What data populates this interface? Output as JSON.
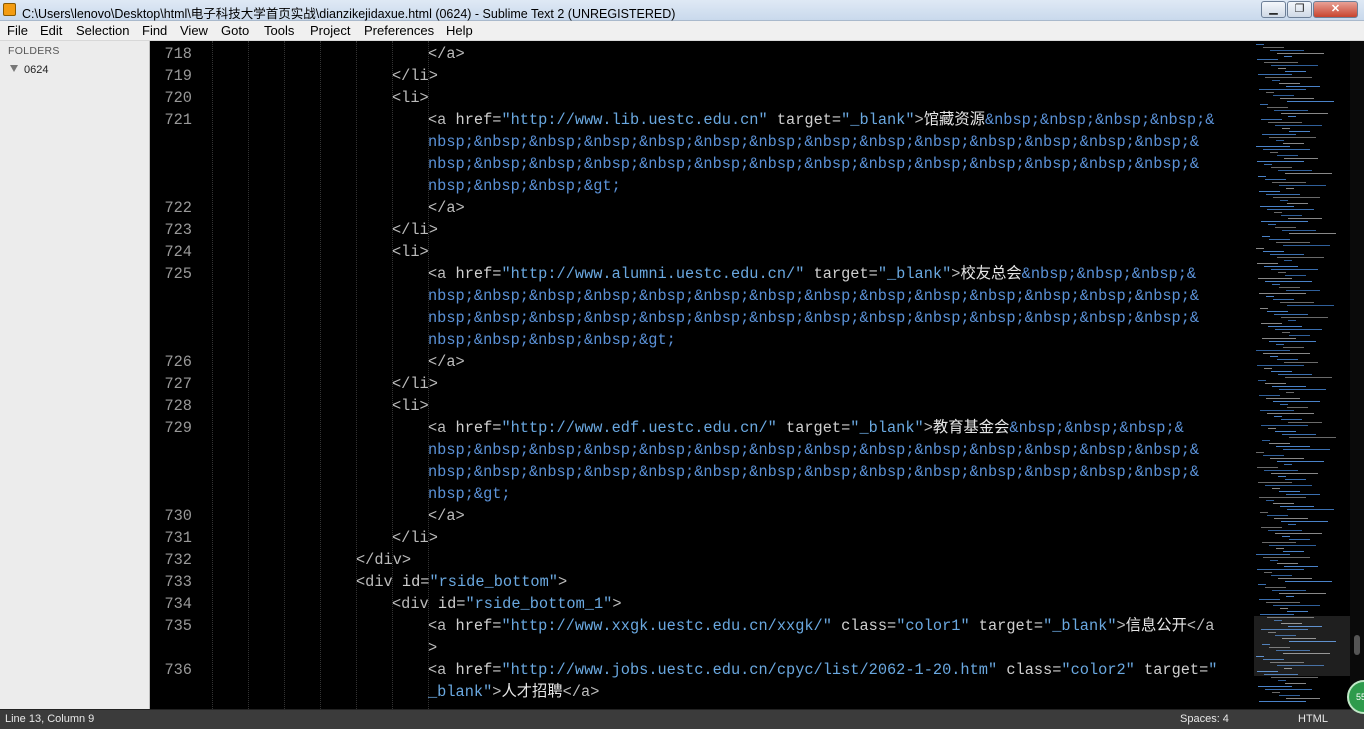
{
  "window": {
    "title": "C:\\Users\\lenovo\\Desktop\\html\\电子科技大学首页实战\\dianzikejidaxue.html (0624) - Sublime Text 2 (UNREGISTERED)",
    "minimize_label": "▁",
    "maximize_label": "❐",
    "close_label": "✕"
  },
  "menu": [
    "File",
    "Edit",
    "Selection",
    "Find",
    "View",
    "Goto",
    "Tools",
    "Project",
    "Preferences",
    "Help"
  ],
  "sidebar": {
    "heading": "FOLDERS",
    "folder": "0624"
  },
  "editor": {
    "lines": [
      {
        "num": "718",
        "indent": 3,
        "parts": [
          {
            "c": "t",
            "t": "</a>"
          }
        ]
      },
      {
        "num": "719",
        "indent": 2,
        "parts": [
          {
            "c": "t",
            "t": "</li>"
          }
        ]
      },
      {
        "num": "720",
        "indent": 2,
        "parts": [
          {
            "c": "t",
            "t": "<li>"
          }
        ]
      },
      {
        "num": "721",
        "indent": 3,
        "parts": [
          {
            "c": "t",
            "t": "<a "
          },
          {
            "c": "a",
            "t": "href="
          },
          {
            "c": "s",
            "t": "\"http://www.lib.uestc.edu.cn\""
          },
          {
            "c": "a",
            "t": " target="
          },
          {
            "c": "s",
            "t": "\"_blank\""
          },
          {
            "c": "t",
            "t": ">"
          },
          {
            "c": "tx",
            "t": "馆藏资源"
          },
          {
            "c": "v",
            "t": "&nbsp;&nbsp;&nbsp;&nbsp;&"
          }
        ]
      },
      {
        "num": "",
        "indent": 3,
        "parts": [
          {
            "c": "v",
            "t": "nbsp;&nbsp;&nbsp;&nbsp;&nbsp;&nbsp;&nbsp;&nbsp;&nbsp;&nbsp;&nbsp;&nbsp;&nbsp;&nbsp;&"
          }
        ]
      },
      {
        "num": "",
        "indent": 3,
        "parts": [
          {
            "c": "v",
            "t": "nbsp;&nbsp;&nbsp;&nbsp;&nbsp;&nbsp;&nbsp;&nbsp;&nbsp;&nbsp;&nbsp;&nbsp;&nbsp;&nbsp;&"
          }
        ]
      },
      {
        "num": "",
        "indent": 3,
        "parts": [
          {
            "c": "v",
            "t": "nbsp;&nbsp;&nbsp;&gt;"
          }
        ]
      },
      {
        "num": "722",
        "indent": 3,
        "parts": [
          {
            "c": "t",
            "t": "</a>"
          }
        ]
      },
      {
        "num": "723",
        "indent": 2,
        "parts": [
          {
            "c": "t",
            "t": "</li>"
          }
        ]
      },
      {
        "num": "724",
        "indent": 2,
        "parts": [
          {
            "c": "t",
            "t": "<li>"
          }
        ]
      },
      {
        "num": "725",
        "indent": 3,
        "parts": [
          {
            "c": "t",
            "t": "<a "
          },
          {
            "c": "a",
            "t": "href="
          },
          {
            "c": "s",
            "t": "\"http://www.alumni.uestc.edu.cn/\""
          },
          {
            "c": "a",
            "t": " target="
          },
          {
            "c": "s",
            "t": "\"_blank\""
          },
          {
            "c": "t",
            "t": ">"
          },
          {
            "c": "tx",
            "t": "校友总会"
          },
          {
            "c": "v",
            "t": "&nbsp;&nbsp;&nbsp;&"
          }
        ]
      },
      {
        "num": "",
        "indent": 3,
        "parts": [
          {
            "c": "v",
            "t": "nbsp;&nbsp;&nbsp;&nbsp;&nbsp;&nbsp;&nbsp;&nbsp;&nbsp;&nbsp;&nbsp;&nbsp;&nbsp;&nbsp;&"
          }
        ]
      },
      {
        "num": "",
        "indent": 3,
        "parts": [
          {
            "c": "v",
            "t": "nbsp;&nbsp;&nbsp;&nbsp;&nbsp;&nbsp;&nbsp;&nbsp;&nbsp;&nbsp;&nbsp;&nbsp;&nbsp;&nbsp;&"
          }
        ]
      },
      {
        "num": "",
        "indent": 3,
        "parts": [
          {
            "c": "v",
            "t": "nbsp;&nbsp;&nbsp;&nbsp;&gt;"
          }
        ]
      },
      {
        "num": "726",
        "indent": 3,
        "parts": [
          {
            "c": "t",
            "t": "</a>"
          }
        ]
      },
      {
        "num": "727",
        "indent": 2,
        "parts": [
          {
            "c": "t",
            "t": "</li>"
          }
        ]
      },
      {
        "num": "728",
        "indent": 2,
        "parts": [
          {
            "c": "t",
            "t": "<li>"
          }
        ]
      },
      {
        "num": "729",
        "indent": 3,
        "parts": [
          {
            "c": "t",
            "t": "<a "
          },
          {
            "c": "a",
            "t": "href="
          },
          {
            "c": "s",
            "t": "\"http://www.edf.uestc.edu.cn/\""
          },
          {
            "c": "a",
            "t": " target="
          },
          {
            "c": "s",
            "t": "\"_blank\""
          },
          {
            "c": "t",
            "t": ">"
          },
          {
            "c": "tx",
            "t": "教育基金会"
          },
          {
            "c": "v",
            "t": "&nbsp;&nbsp;&nbsp;&"
          }
        ]
      },
      {
        "num": "",
        "indent": 3,
        "parts": [
          {
            "c": "v",
            "t": "nbsp;&nbsp;&nbsp;&nbsp;&nbsp;&nbsp;&nbsp;&nbsp;&nbsp;&nbsp;&nbsp;&nbsp;&nbsp;&nbsp;&"
          }
        ]
      },
      {
        "num": "",
        "indent": 3,
        "parts": [
          {
            "c": "v",
            "t": "nbsp;&nbsp;&nbsp;&nbsp;&nbsp;&nbsp;&nbsp;&nbsp;&nbsp;&nbsp;&nbsp;&nbsp;&nbsp;&nbsp;&"
          }
        ]
      },
      {
        "num": "",
        "indent": 3,
        "parts": [
          {
            "c": "v",
            "t": "nbsp;&gt;"
          }
        ]
      },
      {
        "num": "730",
        "indent": 3,
        "parts": [
          {
            "c": "t",
            "t": "</a>"
          }
        ]
      },
      {
        "num": "731",
        "indent": 2,
        "parts": [
          {
            "c": "t",
            "t": "</li>"
          }
        ]
      },
      {
        "num": "732",
        "indent": 1,
        "parts": [
          {
            "c": "t",
            "t": "</div>"
          }
        ]
      },
      {
        "num": "733",
        "indent": 1,
        "parts": [
          {
            "c": "t",
            "t": "<div "
          },
          {
            "c": "a",
            "t": "id="
          },
          {
            "c": "s",
            "t": "\"rside_bottom\""
          },
          {
            "c": "t",
            "t": ">"
          }
        ]
      },
      {
        "num": "734",
        "indent": 2,
        "parts": [
          {
            "c": "t",
            "t": "<div "
          },
          {
            "c": "a",
            "t": "id="
          },
          {
            "c": "s",
            "t": "\"rside_bottom_1\""
          },
          {
            "c": "t",
            "t": ">"
          }
        ]
      },
      {
        "num": "735",
        "indent": 3,
        "parts": [
          {
            "c": "t",
            "t": "<a "
          },
          {
            "c": "a",
            "t": "href="
          },
          {
            "c": "s",
            "t": "\"http://www.xxgk.uestc.edu.cn/xxgk/\""
          },
          {
            "c": "a",
            "t": " class="
          },
          {
            "c": "s",
            "t": "\"color1\""
          },
          {
            "c": "a",
            "t": " target="
          },
          {
            "c": "s",
            "t": "\"_blank\""
          },
          {
            "c": "t",
            "t": ">"
          },
          {
            "c": "tx",
            "t": "信息公开"
          },
          {
            "c": "t",
            "t": "</a"
          }
        ]
      },
      {
        "num": "",
        "indent": 3,
        "parts": [
          {
            "c": "t",
            "t": ">"
          }
        ]
      },
      {
        "num": "736",
        "indent": 3,
        "parts": [
          {
            "c": "t",
            "t": "<a "
          },
          {
            "c": "a",
            "t": "href="
          },
          {
            "c": "s",
            "t": "\"http://www.jobs.uestc.edu.cn/cpyc/list/2062-1-20.htm\""
          },
          {
            "c": "a",
            "t": " class="
          },
          {
            "c": "s",
            "t": "\"color2\""
          },
          {
            "c": "a",
            "t": " target="
          },
          {
            "c": "s",
            "t": "\""
          }
        ]
      },
      {
        "num": "",
        "indent": 3,
        "parts": [
          {
            "c": "s",
            "t": "_blank\""
          },
          {
            "c": "t",
            "t": ">"
          },
          {
            "c": "tx",
            "t": "人才招聘"
          },
          {
            "c": "t",
            "t": "</a>"
          }
        ]
      }
    ]
  },
  "status": {
    "position": "Line 13, Column 9",
    "spaces": "Spaces: 4",
    "syntax": "HTML",
    "badge": "55"
  },
  "colors": {
    "background": "#000000",
    "string": "#6aa8e0",
    "entity": "#5b92d8",
    "status_bar": "#3b3b3b"
  }
}
